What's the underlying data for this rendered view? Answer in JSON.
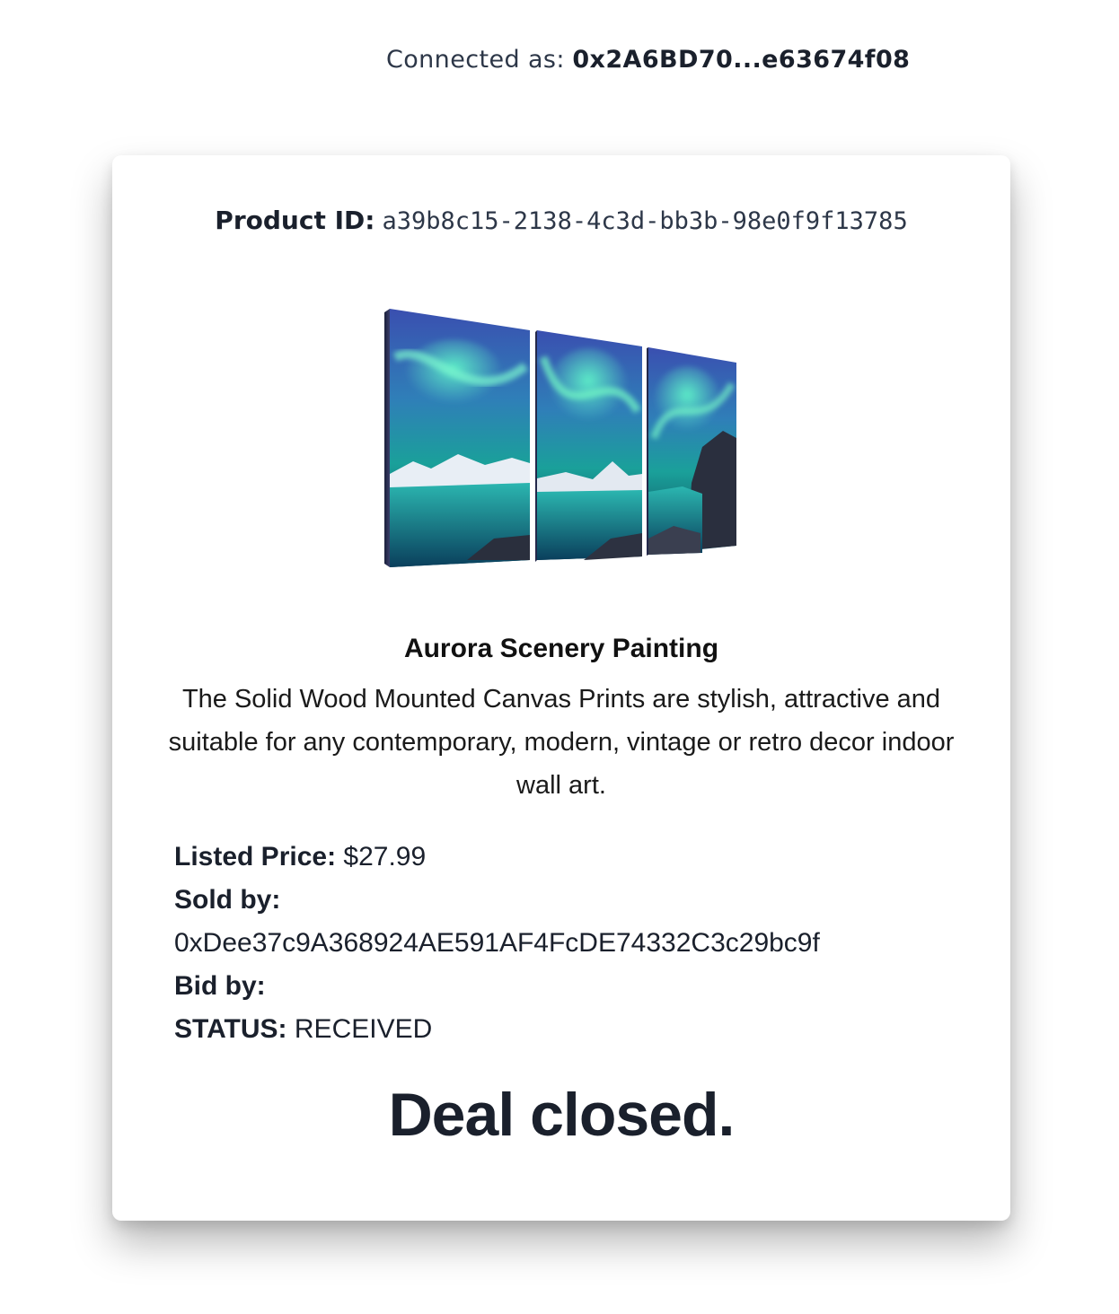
{
  "header": {
    "connected_label": "Connected as:",
    "connected_address": "0x2A6BD70...e63674f08"
  },
  "product": {
    "id_label": "Product ID:",
    "id_value": "a39b8c15-2138-4c3d-bb3b-98e0f9f13785",
    "image_alt": "Aurora Scenery Painting triptych canvas",
    "title": "Aurora Scenery Painting",
    "description": "The Solid Wood Mounted Canvas Prints are stylish, attractive and suitable for any contemporary, modern, vintage or retro decor indoor wall art.",
    "listed_price_label": "Listed Price:",
    "listed_price_value": "$27.99",
    "sold_by_label": "Sold by:",
    "sold_by_value": "0xDee37c9A368924AE591AF4FcDE74332C3c29bc9f",
    "bid_by_label": "Bid by:",
    "bid_by_value": "",
    "status_label": "STATUS:",
    "status_value": "RECEIVED"
  },
  "deal_message": "Deal closed."
}
